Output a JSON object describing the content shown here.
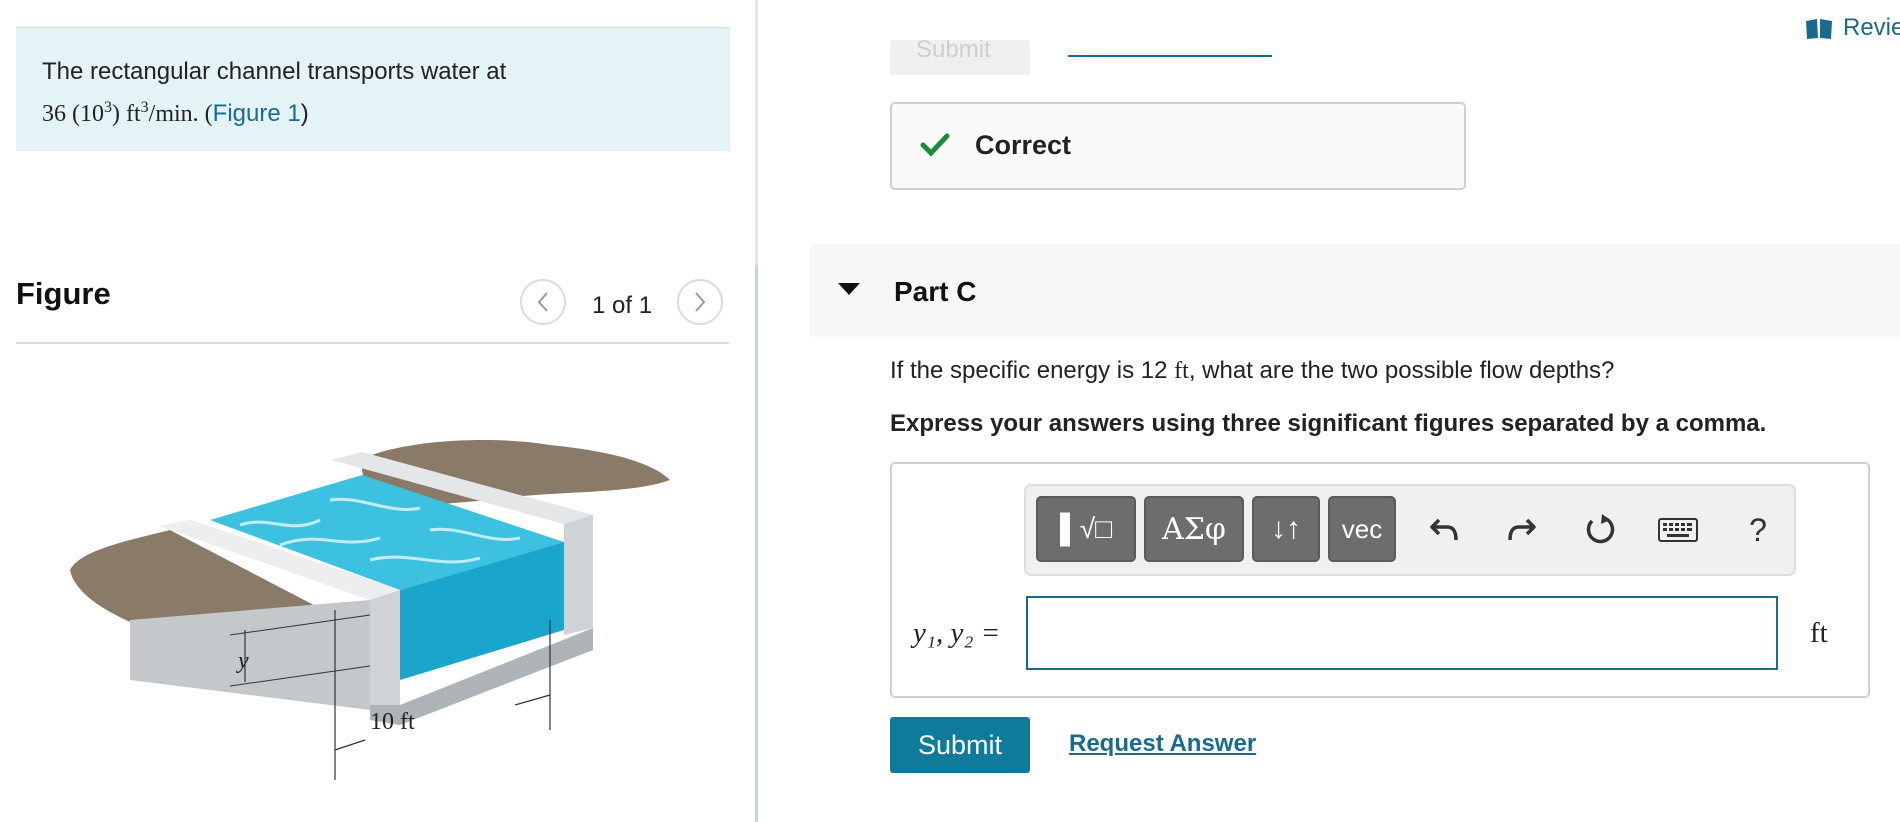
{
  "problem": {
    "text_prefix": "The rectangular channel transports water at",
    "flow_num": "36 (10",
    "flow_exp": "3",
    "flow_mid": ") ft",
    "flow_exp2": "3",
    "flow_unit": "/min. (",
    "figure_link": "Figure 1",
    "close_paren": ")"
  },
  "figure": {
    "title": "Figure",
    "counter": "1 of 1",
    "labels": {
      "depth": "y",
      "width": "10 ft"
    }
  },
  "header": {
    "ghost_submit": "Submit",
    "review_link": "Review"
  },
  "feedback": {
    "correct_label": "Correct"
  },
  "part": {
    "title": "Part C",
    "question_prefix": "If the specific energy is 12 ",
    "question_unit": "ft",
    "question_suffix": ", what are the two possible flow depths?",
    "instruction": "Express your answers using three significant figures separated by a comma."
  },
  "toolbar": {
    "templates_label": "▌√□",
    "greek_label": "ΑΣφ",
    "arrows_label": "↓↑",
    "vec_label": "vec",
    "help_label": "?"
  },
  "answer": {
    "label": "y₁, y₂ =",
    "value": "",
    "unit": "ft"
  },
  "actions": {
    "submit_label": "Submit",
    "request_label": "Request Answer"
  },
  "colors": {
    "accent": "#0f7b9a",
    "link": "#1a6a8f",
    "problem_bg": "#e3f3f6",
    "check": "#1e8a3c",
    "water": "#29b6d8"
  }
}
